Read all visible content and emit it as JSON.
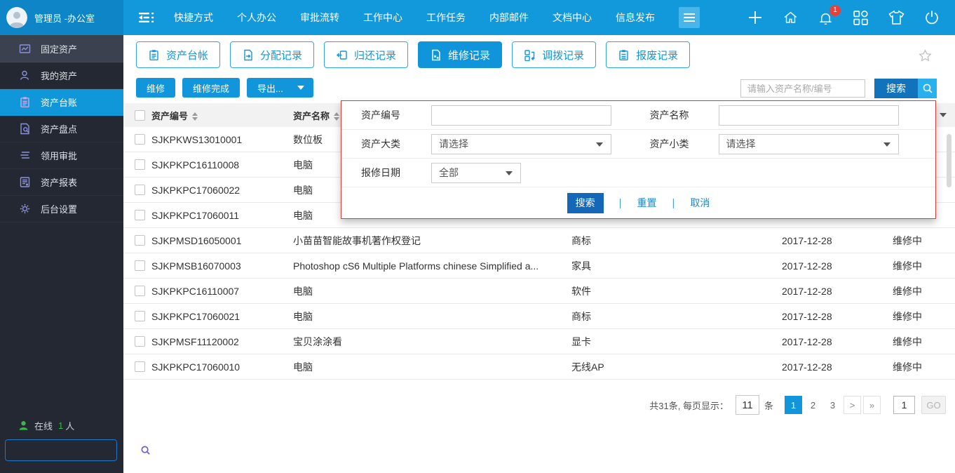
{
  "topbar": {
    "user": "管理员 -办公室",
    "nav": [
      "快捷方式",
      "个人办公",
      "审批流转",
      "工作中心",
      "工作任务",
      "内部邮件",
      "文档中心",
      "信息发布"
    ],
    "notification_count": "1"
  },
  "sidebar": {
    "items": [
      {
        "label": "固定资产"
      },
      {
        "label": "我的资产"
      },
      {
        "label": "资产台账"
      },
      {
        "label": "资产盘点"
      },
      {
        "label": "领用审批"
      },
      {
        "label": "资产报表"
      },
      {
        "label": "后台设置"
      }
    ],
    "online_label": "在线",
    "online_count": "1",
    "online_suffix": "人"
  },
  "tabs": [
    {
      "label": "资产台帐"
    },
    {
      "label": "分配记录"
    },
    {
      "label": "归还记录"
    },
    {
      "label": "维修记录"
    },
    {
      "label": "调拨记录"
    },
    {
      "label": "报废记录"
    }
  ],
  "toolbar": {
    "repair": "维修",
    "repair_done": "维修完成",
    "export": "导出...",
    "search_placeholder": "请输入资产名称/编号",
    "search": "搜索"
  },
  "filter_panel": {
    "labels": {
      "code": "资产编号",
      "name": "资产名称",
      "major": "资产大类",
      "minor": "资产小类",
      "date": "报修日期"
    },
    "select_placeholder": "请选择",
    "date_value": "全部",
    "buttons": {
      "search": "搜索",
      "reset": "重置",
      "cancel": "取消"
    }
  },
  "table": {
    "headers": {
      "code": "资产编号",
      "name": "资产名称"
    },
    "rows": [
      {
        "code": "SJKPKWS13010001",
        "name": "数位板",
        "category": "",
        "date": "",
        "status": ""
      },
      {
        "code": "SJKPKPC16110008",
        "name": "电脑",
        "category": "",
        "date": "",
        "status": ""
      },
      {
        "code": "SJKPKPC17060022",
        "name": "电脑",
        "category": "",
        "date": "",
        "status": ""
      },
      {
        "code": "SJKPKPC17060011",
        "name": "电脑",
        "category": "",
        "date": "",
        "status": ""
      },
      {
        "code": "SJKPMSD16050001",
        "name": "小苗苗智能故事机著作权登记",
        "category": "商标",
        "date": "2017-12-28",
        "status": "维修中"
      },
      {
        "code": "SJKPMSB16070003",
        "name": "Photoshop cS6 Multiple Platforms chinese Simplified a...",
        "category": "家具",
        "date": "2017-12-28",
        "status": "维修中"
      },
      {
        "code": "SJKPKPC16110007",
        "name": "电脑",
        "category": "软件",
        "date": "2017-12-28",
        "status": "维修中"
      },
      {
        "code": "SJKPKPC17060021",
        "name": "电脑",
        "category": "商标",
        "date": "2017-12-28",
        "status": "维修中"
      },
      {
        "code": "SJKPMSF11120002",
        "name": "宝贝涂涂看",
        "category": "显卡",
        "date": "2017-12-28",
        "status": "维修中"
      },
      {
        "code": "SJKPKPC17060010",
        "name": "电脑",
        "category": "无线AP",
        "date": "2017-12-28",
        "status": "维修中"
      }
    ]
  },
  "pagination": {
    "summary": "共31条, 每页显示：",
    "page_size": "11",
    "unit": "条",
    "pages": [
      "1",
      "2",
      "3"
    ],
    "next": ">",
    "last": "»",
    "jump_value": "1",
    "go": "GO"
  },
  "colors": {
    "primary": "#1296db",
    "primary_dark": "#1173bb",
    "accent_light": "#27b1ee",
    "panel_border": "#dd3a34",
    "online_green": "#3cb54a",
    "sidebar_bg": "#232833",
    "badge_red": "#e8413c"
  }
}
